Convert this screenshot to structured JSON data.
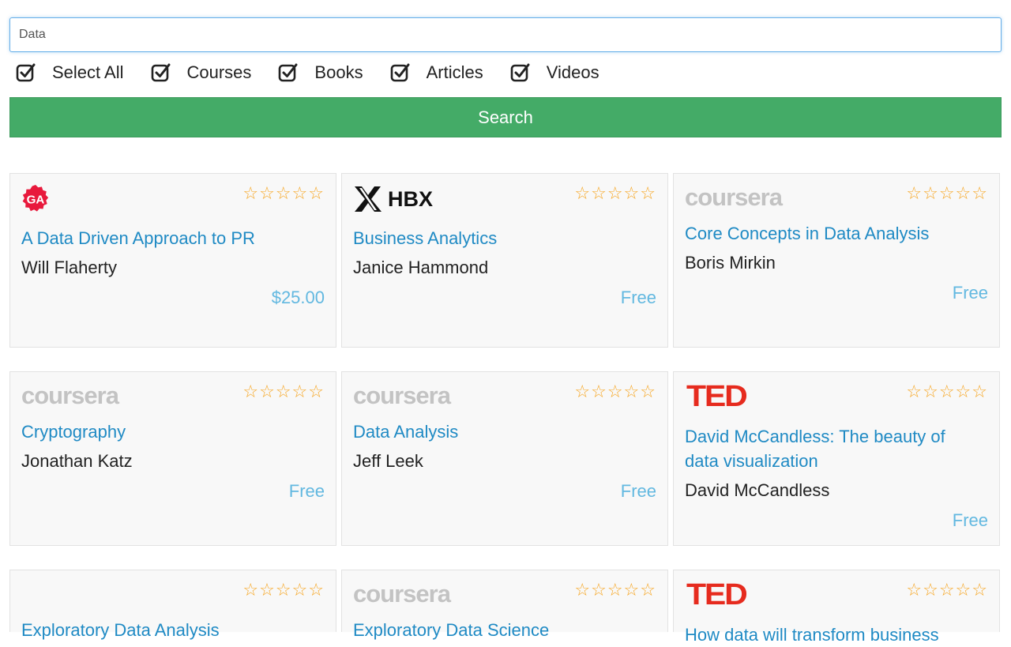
{
  "search": {
    "value": "Data",
    "button_label": "Search"
  },
  "filters": [
    {
      "label": "Select All",
      "checked": true
    },
    {
      "label": "Courses",
      "checked": true
    },
    {
      "label": "Books",
      "checked": true
    },
    {
      "label": "Articles",
      "checked": true
    },
    {
      "label": "Videos",
      "checked": true
    }
  ],
  "results": [
    {
      "logo": "GA",
      "title": "A Data Driven Approach to PR",
      "author": "Will Flaherty",
      "price": "$25.00",
      "stars": "☆☆☆☆☆"
    },
    {
      "logo": "HBX",
      "title": "Business Analytics",
      "author": "Janice Hammond",
      "price": "Free",
      "stars": "☆☆☆☆☆"
    },
    {
      "logo": "coursera",
      "title": "Core Concepts in Data Analysis",
      "author": "Boris Mirkin",
      "price": "Free",
      "stars": "☆☆☆☆☆"
    },
    {
      "logo": "coursera",
      "title": "Cryptography",
      "author": "Jonathan Katz",
      "price": "Free",
      "stars": "☆☆☆☆☆"
    },
    {
      "logo": "coursera",
      "title": "Data Analysis",
      "author": "Jeff Leek",
      "price": "Free",
      "stars": "☆☆☆☆☆"
    },
    {
      "logo": "TED",
      "title": "David McCandless: The beauty of data visualization",
      "author": "David McCandless",
      "price": "Free",
      "stars": "☆☆☆☆☆"
    },
    {
      "logo": "",
      "title": "Exploratory Data Analysis",
      "author": "",
      "price": "",
      "stars": "☆☆☆☆☆"
    },
    {
      "logo": "coursera",
      "title": "Exploratory Data Science",
      "author": "",
      "price": "",
      "stars": "☆☆☆☆☆"
    },
    {
      "logo": "TED",
      "title": "How data will transform business",
      "author": "",
      "price": "",
      "stars": "☆☆☆☆☆"
    }
  ],
  "colors": {
    "accent_green": "#44ab67",
    "link_blue": "#1f8ac4",
    "price_blue": "#62b8e0",
    "star_orange": "#f6a623",
    "ted_red": "#e62b1e",
    "ga_red": "#e8193c"
  }
}
